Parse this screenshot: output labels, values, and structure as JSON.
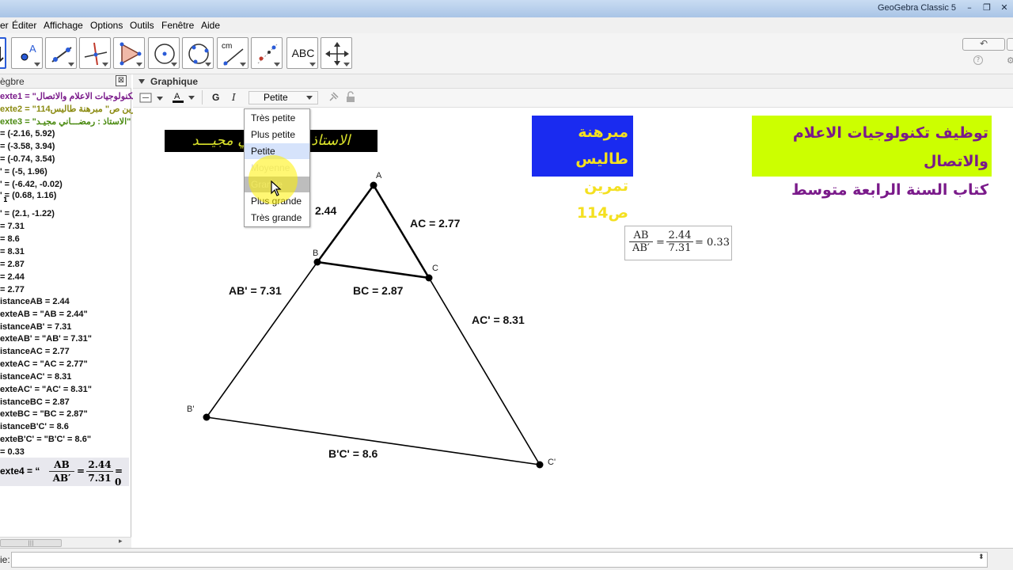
{
  "window": {
    "title": "GeoGebra Classic 5",
    "controls": [
      "–",
      "❐",
      "✕"
    ]
  },
  "menu": {
    "items": [
      "er",
      "Éditer",
      "Affichage",
      "Options",
      "Outils",
      "Fenêtre",
      "Aide"
    ]
  },
  "toolbar": {
    "tools": [
      {
        "icon": "move-icon"
      },
      {
        "icon": "point-icon"
      },
      {
        "icon": "line-icon"
      },
      {
        "icon": "perpendicular-line-icon"
      },
      {
        "icon": "polygon-icon"
      },
      {
        "icon": "circle-center-point-icon"
      },
      {
        "icon": "circle-three-points-icon"
      },
      {
        "icon": "measure-distance-icon",
        "label": "cm"
      },
      {
        "icon": "reflect-point-icon"
      },
      {
        "icon": "text-tool-icon",
        "label": "ABC"
      },
      {
        "icon": "move-graphics-icon"
      }
    ],
    "undo_label": "↶",
    "help_label": "?",
    "settings_label": "⚙"
  },
  "algebra": {
    "title": "ègbre",
    "close_label": "⊠",
    "rows": [
      {
        "text": "exte1 = \"تكنولوجيات الاعلام والاتصال",
        "style": "purple"
      },
      {
        "text": "exte2 = \"114رين ص\" مبرهنة طاليس",
        "style": "olive"
      },
      {
        "text": "exte3 = \"الاستاذ : رمضـــاني مجيـد\"",
        "style": "green"
      },
      {
        "text": "= (-2.16, 5.92)"
      },
      {
        "text": "= (-3.58, 3.94)"
      },
      {
        "text": "= (-0.74, 3.54)"
      },
      {
        "text": "' = (-5, 1.96)"
      },
      {
        "text": "' = (-6.42, -0.02)"
      },
      {
        "text": "' = (0.68, 1.16)",
        "sub": "1"
      },
      {
        "text": "' = (2.1, -1.22)"
      },
      {
        "text": "= 7.31"
      },
      {
        "text": "= 8.6"
      },
      {
        "text": "= 8.31"
      },
      {
        "text": "= 2.87"
      },
      {
        "text": "= 2.44"
      },
      {
        "text": "= 2.77"
      },
      {
        "text": "istanceAB = 2.44"
      },
      {
        "text": "exteAB = \"AB = 2.44\""
      },
      {
        "text": "istanceAB' = 7.31"
      },
      {
        "text": "exteAB' = \"AB' = 7.31\""
      },
      {
        "text": "istanceAC = 2.77"
      },
      {
        "text": "exteAC = \"AC = 2.77\""
      },
      {
        "text": "istanceAC' = 8.31"
      },
      {
        "text": "exteAC' = \"AC' = 8.31\""
      },
      {
        "text": "istanceBC = 2.87"
      },
      {
        "text": "exteBC = \"BC = 2.87\""
      },
      {
        "text": "istanceB'C' = 8.6"
      },
      {
        "text": "exteB'C' = \"B'C' = 8.6\""
      },
      {
        "text": "= 0.33"
      }
    ],
    "formula": {
      "prefix": "exte4 = “",
      "num1": "AB",
      "den1": "AB′",
      "eq": "=",
      "num2": "2.44",
      "den2": "7.31",
      "tail": "= 0"
    },
    "scroll_label": "|||",
    "scroll_right": "▸"
  },
  "graphics": {
    "title": "Graphique",
    "stylebar": {
      "bold": "G",
      "italic": "I",
      "size_value": "Petite",
      "text_color_label": "A"
    },
    "dropdown": {
      "options": [
        "Très petite",
        "Plus petite",
        "Petite",
        "Moyenne",
        "Grande",
        "Plus grande",
        "Très grande"
      ],
      "selected": "Petite",
      "hovered": "Grande"
    },
    "banners": {
      "teacher": "الاستاذ : رمضـــاني مجيـــد",
      "thales_title": "مبرهنة طاليس",
      "exercise": "تمرين ص114",
      "tice": "توظيف تكنولوجيات الاعلام والاتصال",
      "book": "كتاب السنة الرابعة متوسط"
    },
    "points": {
      "A": "A",
      "B": "B",
      "C": "C",
      "Bp": "B'",
      "Cp": "C'"
    },
    "labels": {
      "AB": "2.44",
      "AC": "AC = 2.77",
      "BC": "BC = 2.87",
      "ABp": "AB' = 7.31",
      "ACp": "AC' = 8.31",
      "BpCp": "B'C' = 8.6"
    },
    "ratio": {
      "num1": "AB",
      "den1": "AB′",
      "num2": "2.44",
      "den2": "7.31",
      "eq1": "=",
      "result": "= 0.33"
    },
    "colors": {
      "banner_blue_bg": "#1a2bf0",
      "banner_blue_fg": "#f4e020",
      "banner_lime_bg": "#ccff00",
      "banner_lime_fg": "#7a1a8a",
      "banner_black_fg": "#d8e02a"
    }
  },
  "input_bar": {
    "label": "ie:",
    "value": "",
    "spinner": "⬍"
  }
}
